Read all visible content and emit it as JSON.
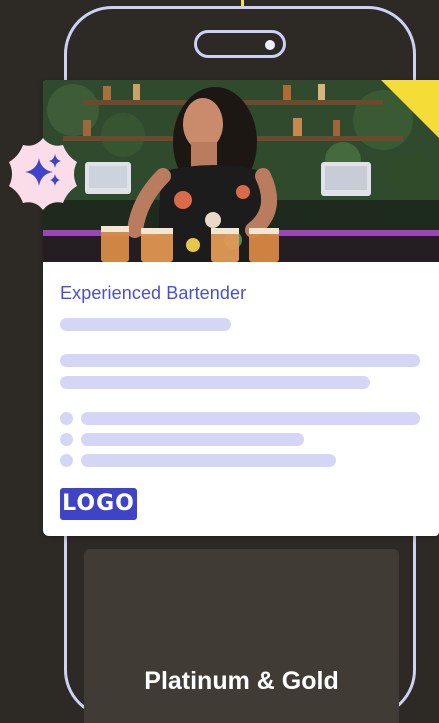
{
  "job_card": {
    "title": "Experienced Bartender",
    "logo_text": "LOGO",
    "image_subject": "bartender-photo"
  },
  "tier": {
    "label": "Platinum & Gold"
  },
  "icons": {
    "badge": "sparkles-icon"
  },
  "colors": {
    "background": "#2d2a26",
    "phone_outline": "#cfd0f5",
    "accent_blue": "#4a4fd0",
    "placeholder_bar": "#d5d6f6",
    "logo_bg": "#3f43c8",
    "corner_yellow": "#f5dc36",
    "badge_pink": "#fbdde9"
  }
}
